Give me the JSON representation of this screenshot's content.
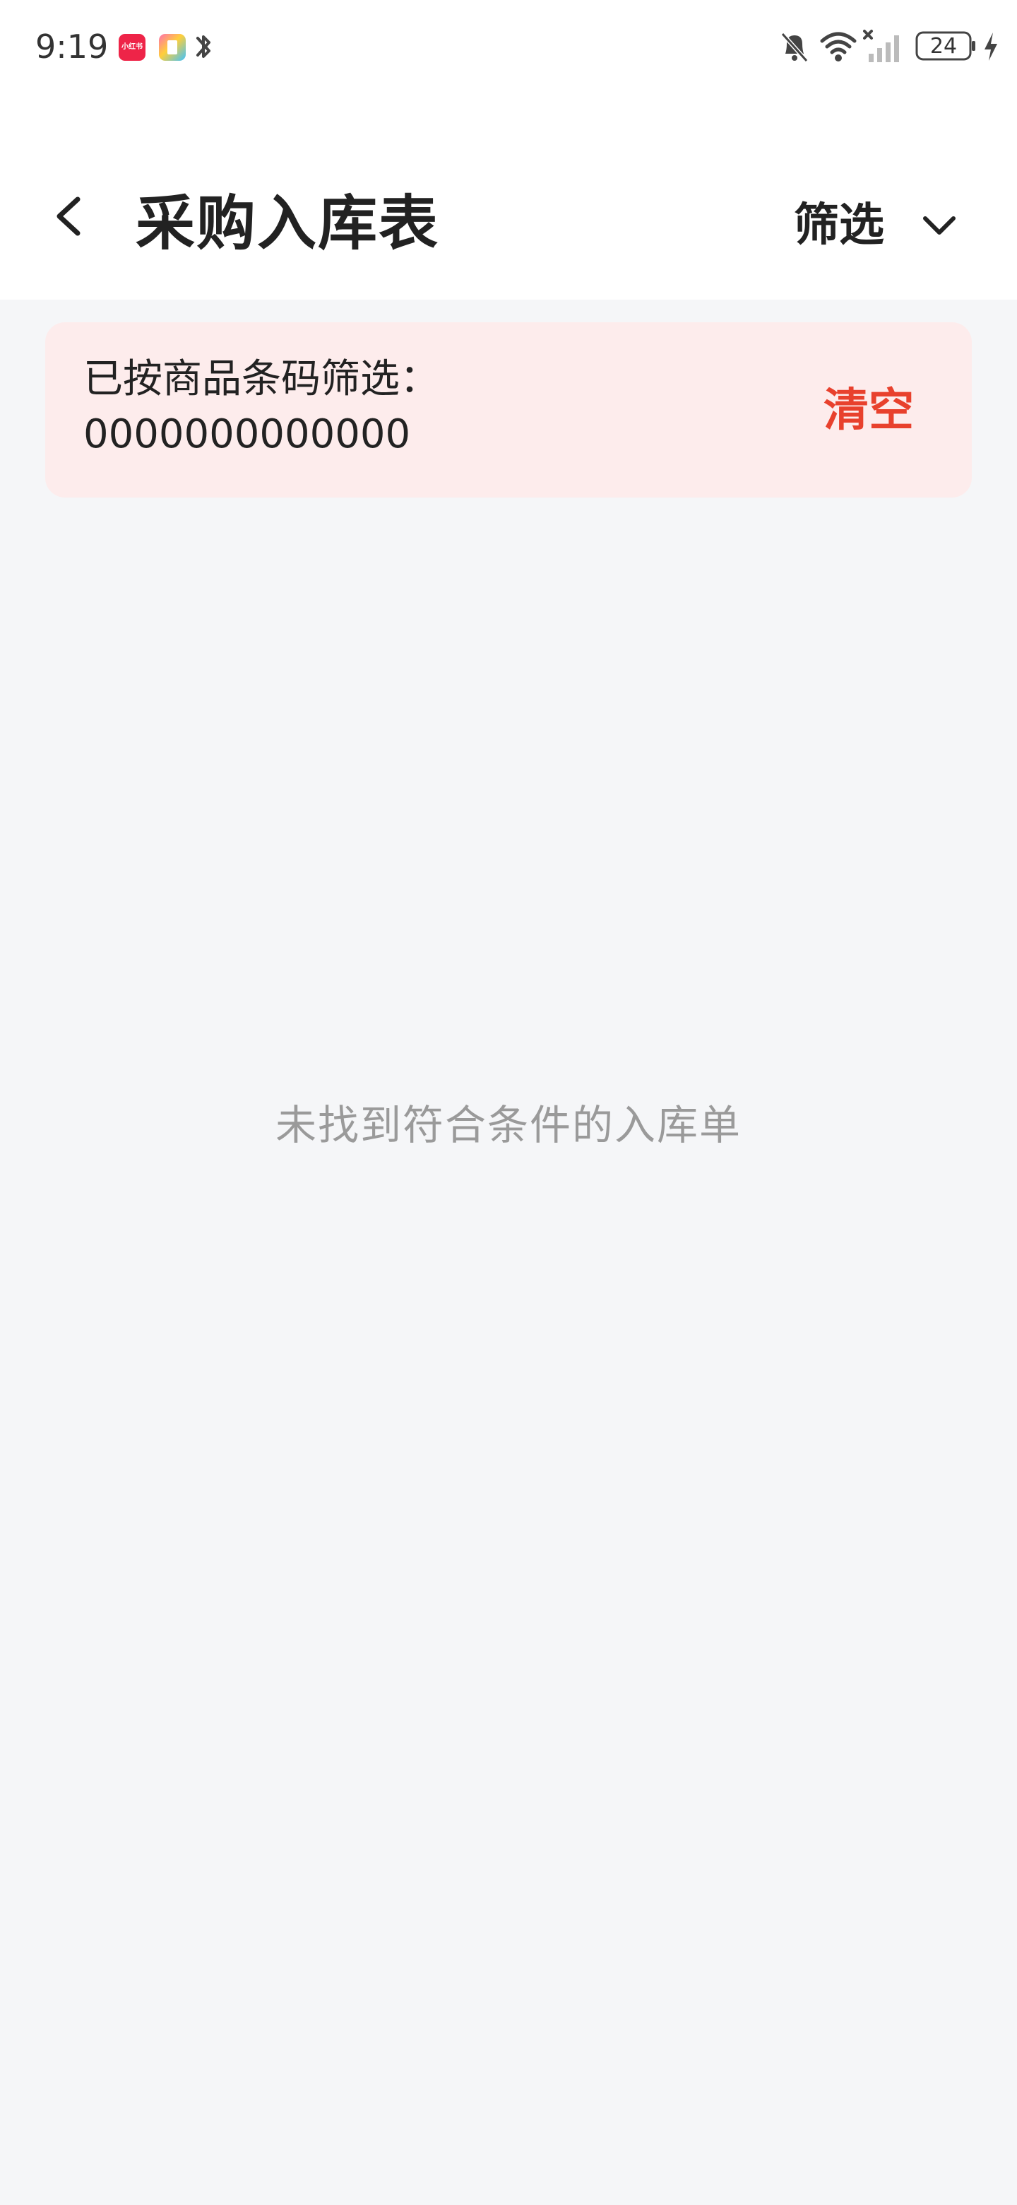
{
  "status_bar": {
    "time": "9:19",
    "app_badge_label": "小红书",
    "battery_level": "24",
    "icons": [
      "xiaohongshu-app-icon",
      "color-app-icon",
      "bluetooth-icon",
      "bell-off-icon",
      "wifi-icon",
      "signal-icon",
      "battery-icon",
      "charging-icon"
    ]
  },
  "header": {
    "title": "采购入库表",
    "filter_label": "筛选",
    "back_icon": "chevron-left-icon",
    "filter_icon": "chevron-down-icon"
  },
  "filter_banner": {
    "prefix": "已按商品条码筛选：",
    "barcode": "0000000000000",
    "clear_label": "清空",
    "background_color": "#fdecec",
    "accent_color": "#e8412d"
  },
  "empty_state": {
    "message": "未找到符合条件的入库单"
  }
}
